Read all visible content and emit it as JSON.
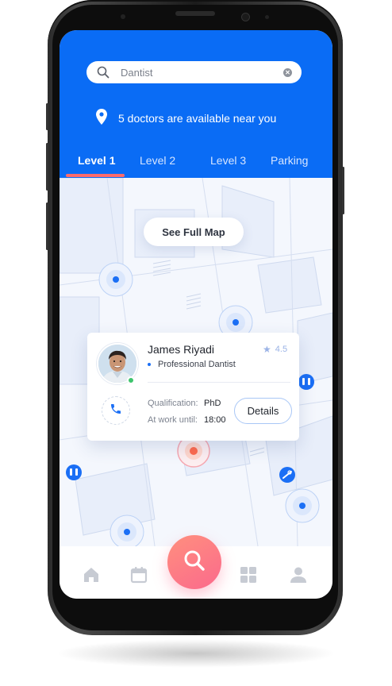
{
  "search": {
    "value": "Dantist"
  },
  "availability": {
    "text": "5 doctors are available near you"
  },
  "tabs": [
    {
      "label": "Level 1",
      "active": true
    },
    {
      "label": "Level 2",
      "active": false
    },
    {
      "label": "Level 3",
      "active": false
    },
    {
      "label": "Parking",
      "active": false
    }
  ],
  "map": {
    "full_map_label": "See Full Map"
  },
  "doctor_card": {
    "name": "James Riyadi",
    "rating": "4.5",
    "role": "Professional Dantist",
    "qualification_label": "Qualification:",
    "qualification_value": "PhD",
    "work_label": "At work until:",
    "work_value": "18:00",
    "details_label": "Details",
    "status": "online"
  },
  "bottom_nav": {
    "items": [
      "home-icon",
      "calendar-icon",
      "search-icon",
      "grid-icon",
      "profile-icon"
    ]
  },
  "colors": {
    "primary": "#0a6cf5",
    "accent": "#ff6b6b",
    "fab_gradient_start": "#ff8f7e",
    "fab_gradient_end": "#fb6a8c",
    "online": "#3ec46d"
  }
}
